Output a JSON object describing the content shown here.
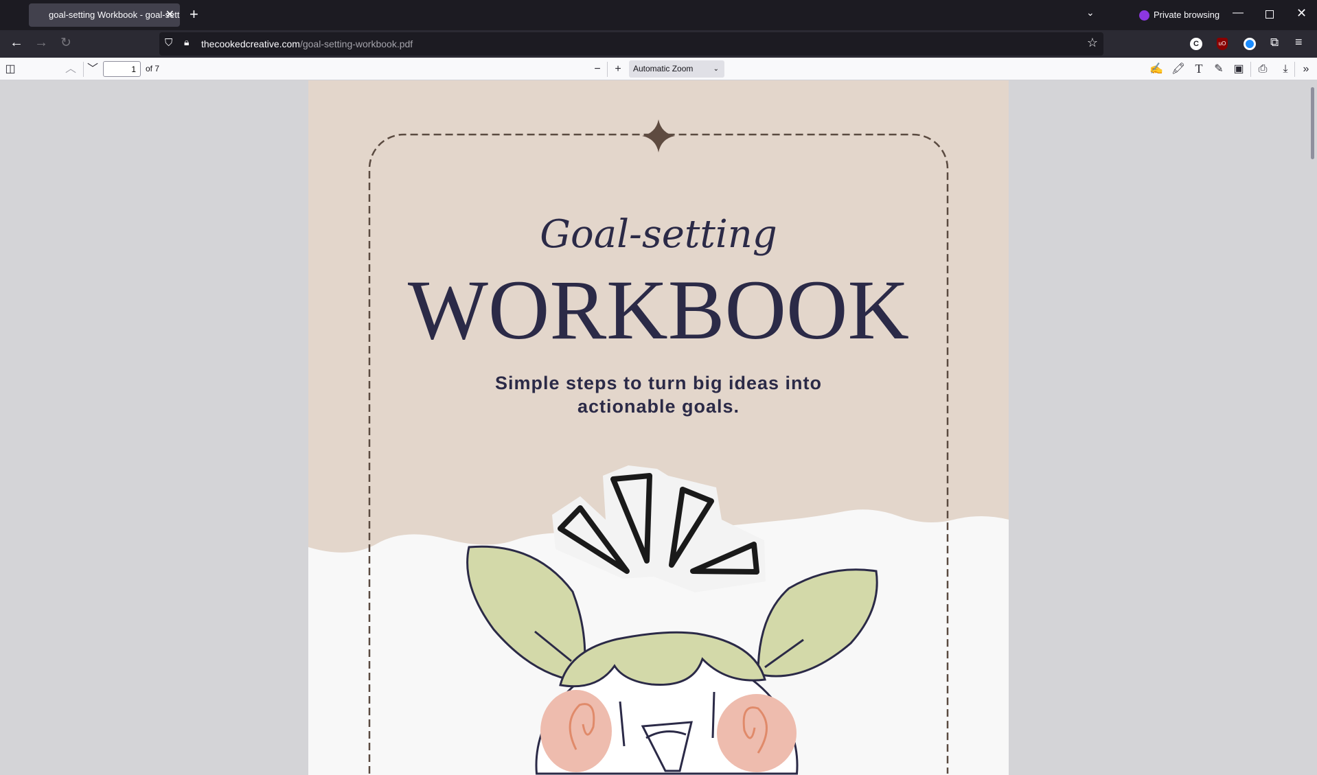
{
  "browser": {
    "tab_title": "goal-setting Workbook - goal-setting-workbook.pdf",
    "new_tab": "+",
    "private_label": "Private browsing",
    "url_host": "thecookedcreative.com",
    "url_path": "/goal-setting-workbook.pdf",
    "extensions": [
      "C",
      "uO"
    ]
  },
  "pdf_toolbar": {
    "page_number": "1",
    "page_count": "of 7",
    "zoom": "Automatic Zoom"
  },
  "document": {
    "script_title": "Goal-setting",
    "title": "WORKBOOK",
    "subtitle_line1": "Simple steps to turn big ideas into",
    "subtitle_line2": "actionable goals."
  },
  "colors": {
    "beige": "#e3d6cb",
    "navy": "#2b2a47",
    "leaf": "#d3d9a9",
    "cheek": "#eebcae"
  }
}
